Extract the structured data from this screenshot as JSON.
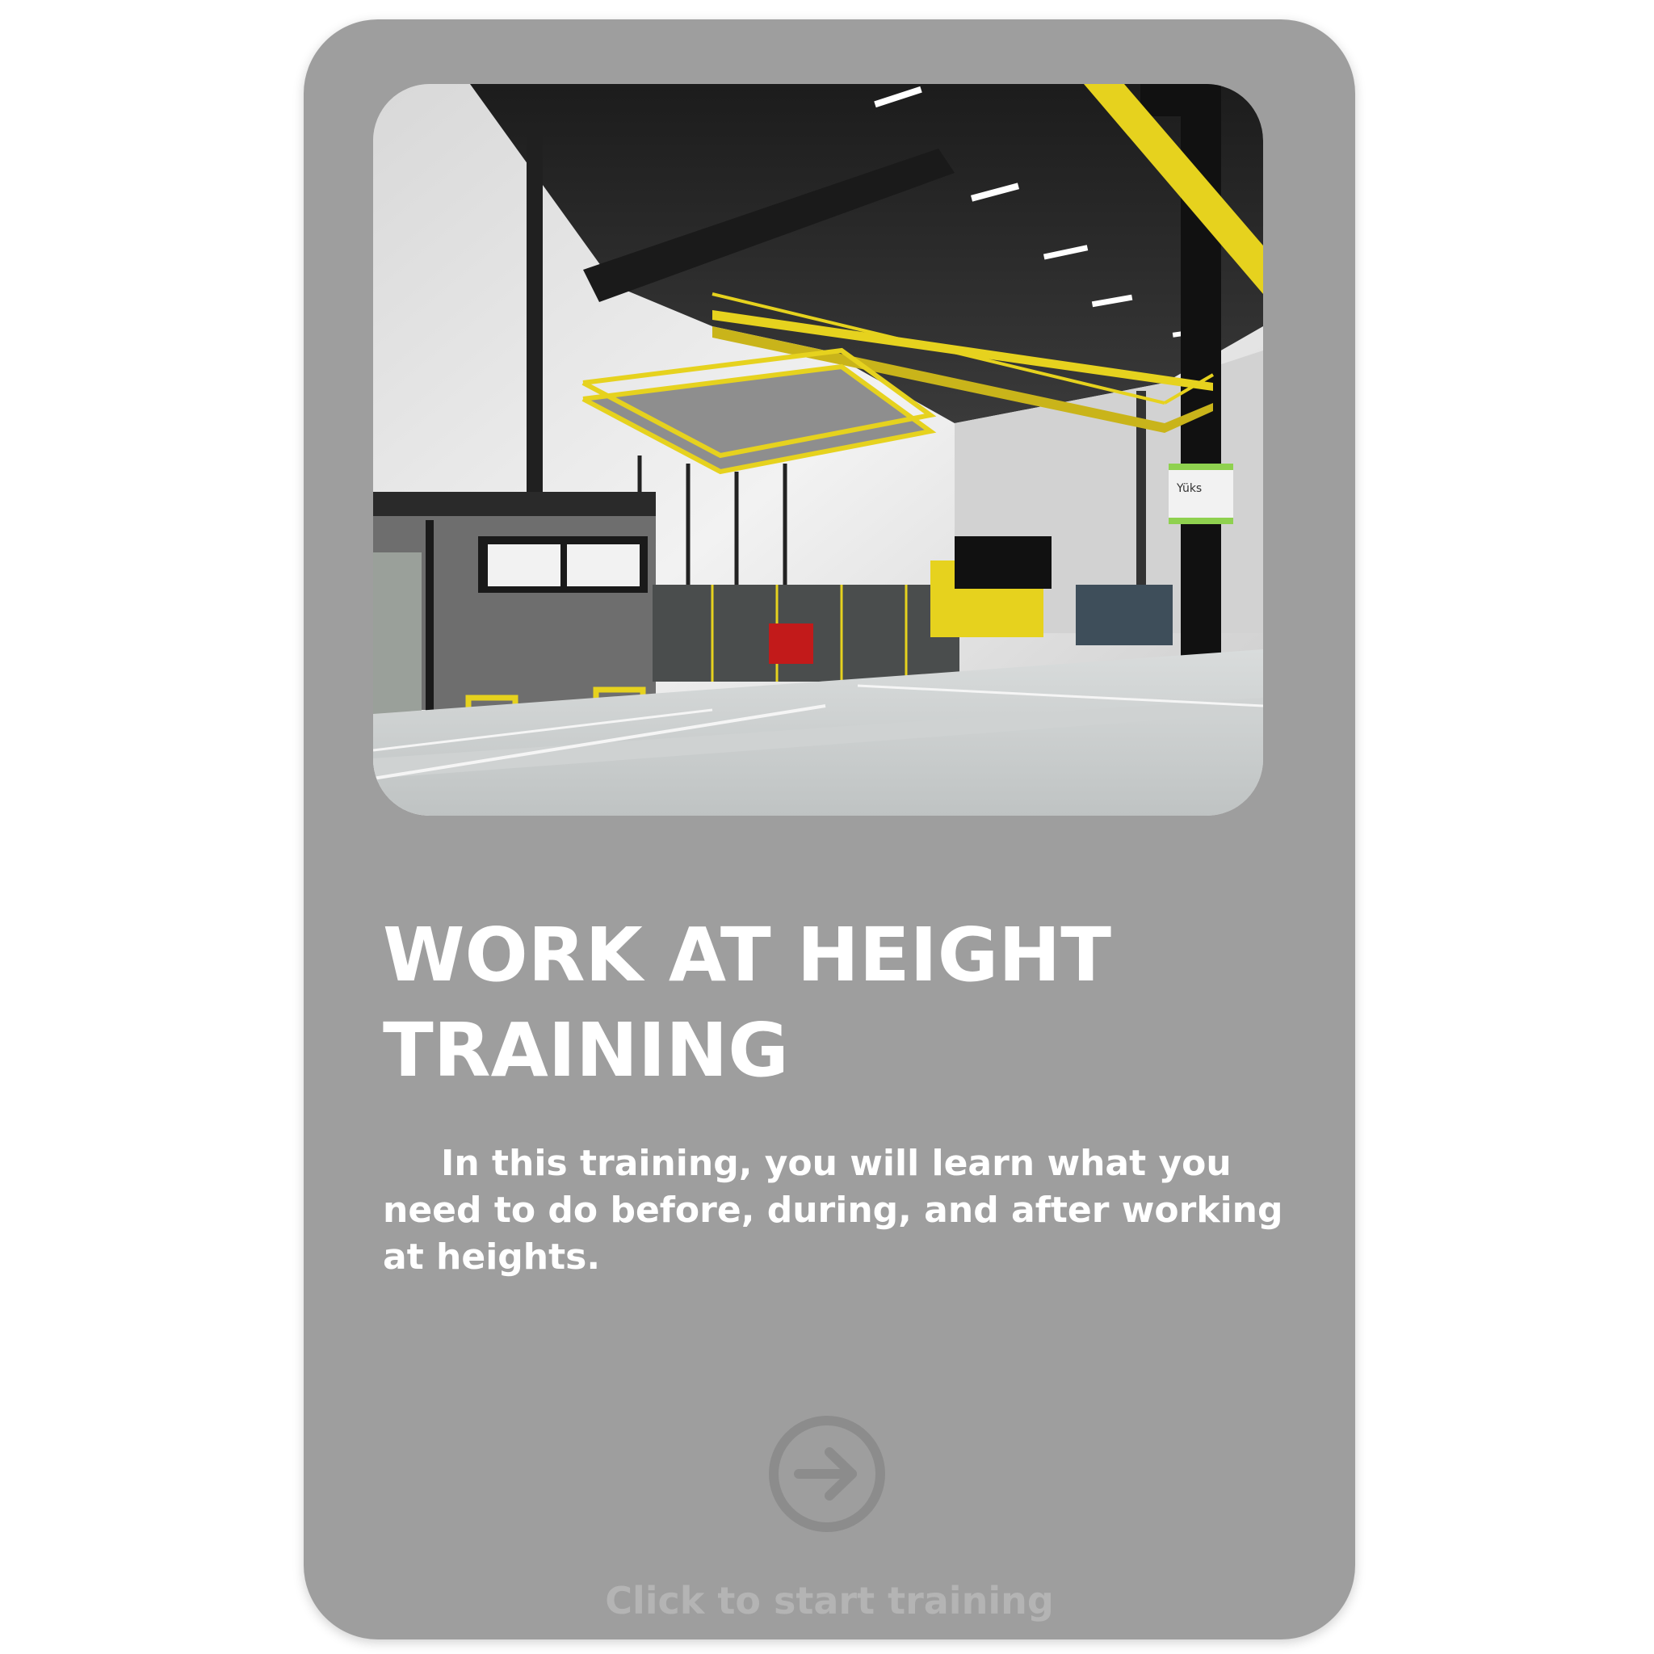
{
  "card": {
    "title": "WORK AT HEIGHT TRAINING",
    "description": "In this training, you will learn what you need to do before, during, and after working at heights.",
    "start_icon": "arrow-right-circle-icon",
    "start_label": "Click to start training",
    "image": "warehouse-3d-scene",
    "sign_text": "Yüks",
    "colors": {
      "card_background": "#9e9e9e",
      "title": "#ffffff",
      "description": "#ffffff",
      "start_label": "#b4b4b4",
      "start_icon": "#8c8c8c",
      "accent_yellow": "#e6d21e"
    }
  }
}
